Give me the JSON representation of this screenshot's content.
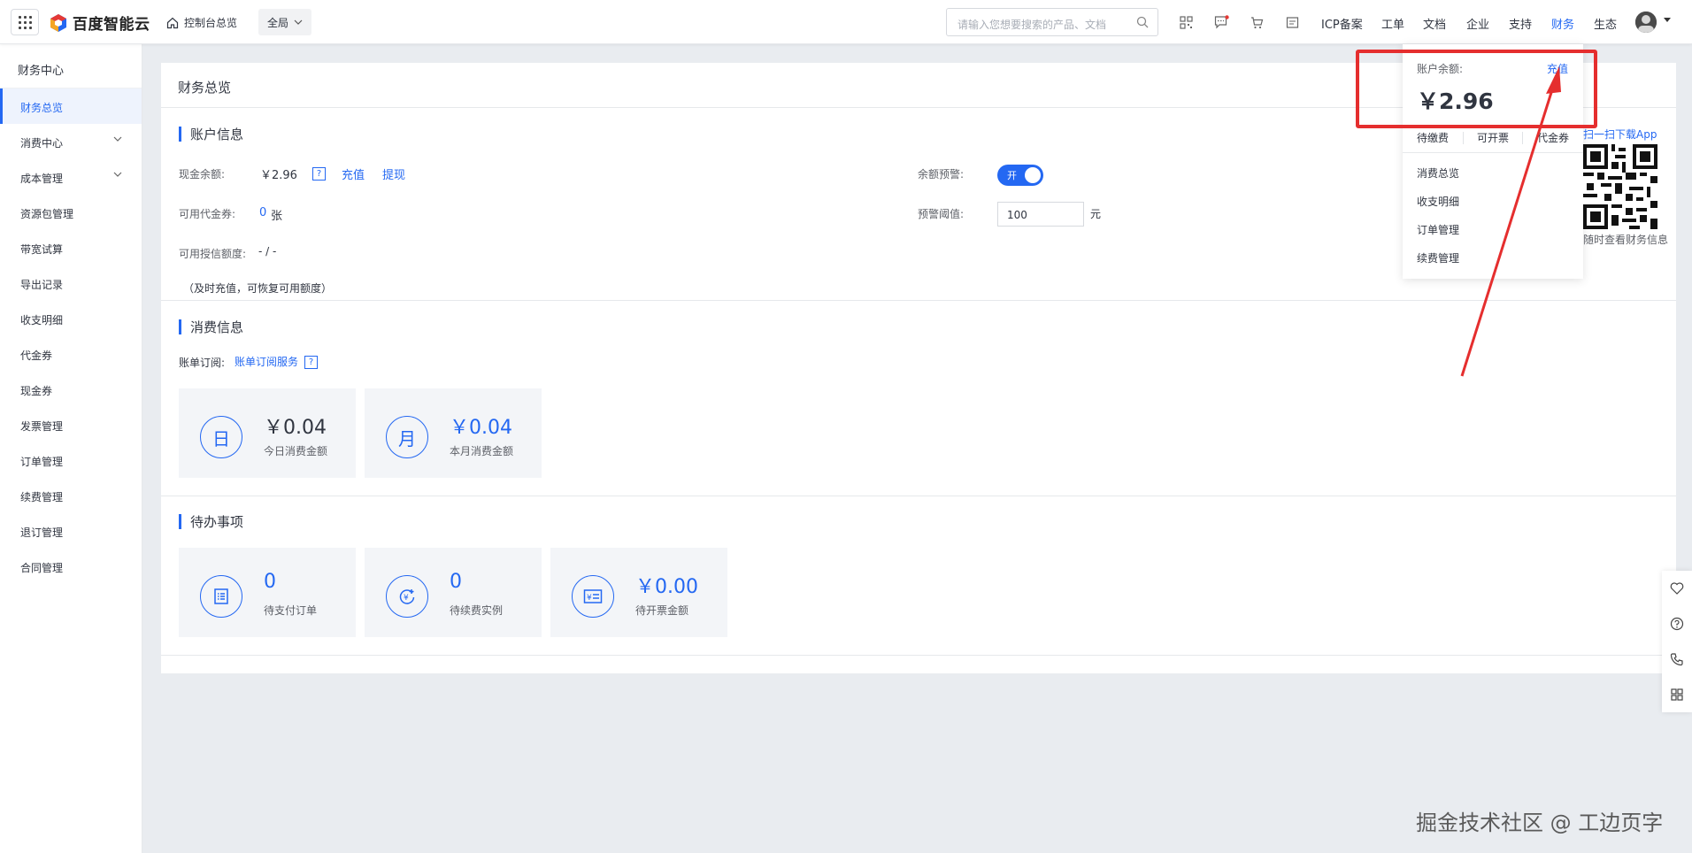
{
  "topbar": {
    "logo_text": "百度智能云",
    "console_label": "控制台总览",
    "region_label": "全局",
    "search_placeholder": "请输入您想要搜索的产品、文档",
    "nav": [
      "ICP备案",
      "工单",
      "文档",
      "企业",
      "支持",
      "财务",
      "生态"
    ],
    "active_nav": "财务"
  },
  "sidebar": {
    "title": "财务中心",
    "items": [
      {
        "label": "财务总览",
        "active": true
      },
      {
        "label": "消费中心",
        "expandable": true
      },
      {
        "label": "成本管理",
        "expandable": true
      },
      {
        "label": "资源包管理"
      },
      {
        "label": "带宽试算"
      },
      {
        "label": "导出记录"
      },
      {
        "label": "收支明细"
      },
      {
        "label": "代金券"
      },
      {
        "label": "现金券"
      },
      {
        "label": "发票管理"
      },
      {
        "label": "订单管理"
      },
      {
        "label": "续费管理"
      },
      {
        "label": "退订管理"
      },
      {
        "label": "合同管理"
      }
    ]
  },
  "main": {
    "title": "财务总览",
    "account": {
      "section_title": "账户信息",
      "cash_label": "现金余额:",
      "cash_value": "￥2.96",
      "qmark": "?",
      "recharge": "充值",
      "withdraw": "提现",
      "voucher_label": "可用代金券:",
      "voucher_count": "0",
      "voucher_unit": "张",
      "credit_label": "可用授信额度:",
      "credit_value": "- / -",
      "credit_note": "（及时充值，可恢复可用额度）",
      "alert_label": "余额预警:",
      "alert_toggle": "开",
      "threshold_label": "预警阈值:",
      "threshold_value": "100",
      "threshold_unit": "元"
    },
    "consumption": {
      "section_title": "消费信息",
      "subscribe_label": "账单订阅:",
      "subscribe_link": "账单订阅服务",
      "qmark": "?",
      "cards": [
        {
          "icon_char": "日",
          "value": "￥0.04",
          "caption": "今日消费金额"
        },
        {
          "icon_char": "月",
          "value": "￥0.04",
          "caption": "本月消费金额"
        }
      ]
    },
    "todo": {
      "section_title": "待办事项",
      "cards": [
        {
          "value": "0",
          "caption": "待支付订单"
        },
        {
          "value": "0",
          "caption": "待续费实例"
        },
        {
          "value": "￥0.00",
          "caption": "待开票金额"
        }
      ]
    }
  },
  "popover": {
    "balance_label": "账户余额:",
    "recharge": "充值",
    "balance": "￥2.96",
    "tabs": [
      "待缴费",
      "可开票",
      "代金券"
    ],
    "items": [
      "消费总览",
      "收支明细",
      "订单管理",
      "续费管理"
    ],
    "app_prompt": "扫一扫下载App",
    "app_note": "随时查看财务信息"
  },
  "watermark": "掘金技术社区 @ 工边页字",
  "colors": {
    "accent": "#2468f2",
    "annotation": "#e52e2e"
  }
}
